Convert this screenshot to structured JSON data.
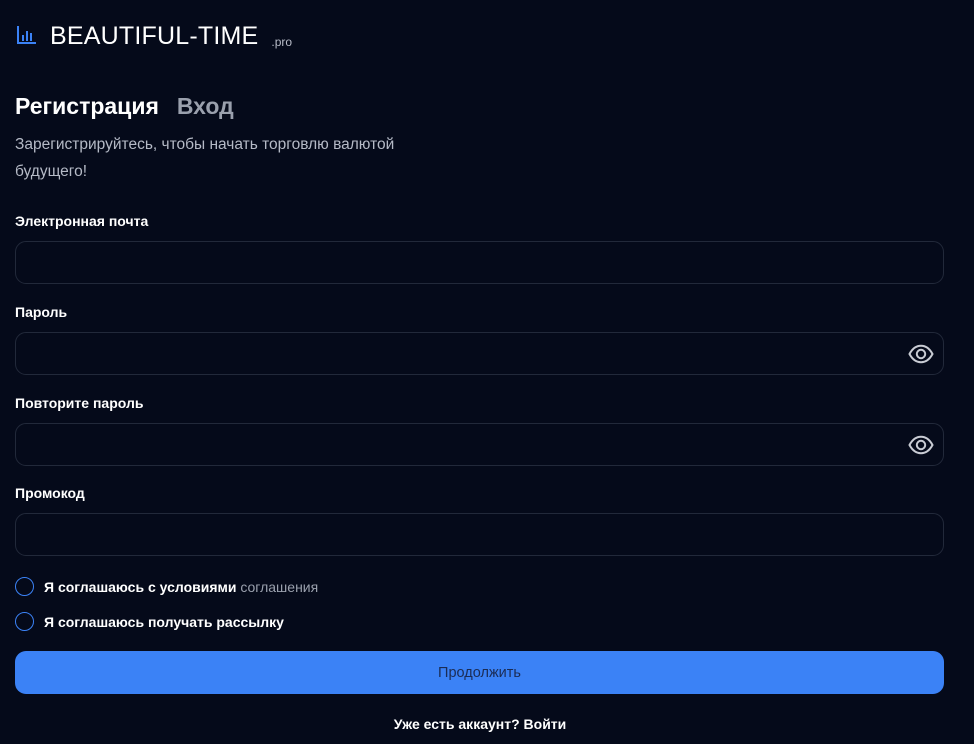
{
  "brand": {
    "name": "BEAUTIFUL-TIME",
    "suffix": ".pro",
    "icon": "bar-chart-icon",
    "accent": "#3b82f6"
  },
  "tabs": [
    {
      "label": "Регистрация",
      "active": true
    },
    {
      "label": "Вход",
      "active": false
    }
  ],
  "subtitle": "Зарегистрируйтесь, чтобы начать торговлю валютой будущего!",
  "form": {
    "email": {
      "label": "Электронная почта",
      "value": "",
      "placeholder": ""
    },
    "password": {
      "label": "Пароль",
      "value": "",
      "placeholder": "",
      "icon": "eye-icon"
    },
    "repeat_password": {
      "label": "Повторите пароль",
      "value": "",
      "placeholder": "",
      "icon": "eye-icon"
    },
    "promo": {
      "label": "Промокод",
      "value": "",
      "placeholder": ""
    }
  },
  "agreements": {
    "terms_prefix": "Я соглашаюсь с условиями",
    "terms_link": "соглашения",
    "terms_checked": false,
    "newsletter": "Я соглашаюсь получать рассылку",
    "newsletter_checked": false
  },
  "continue_label": "Продолжить",
  "footer": {
    "question": "Уже есть аккаунт?",
    "login_link": "Войти"
  },
  "colors": {
    "background": "#050a1a",
    "field_border": "#22293a",
    "muted_text": "#9aa0ad",
    "button": "#3b82f6"
  }
}
